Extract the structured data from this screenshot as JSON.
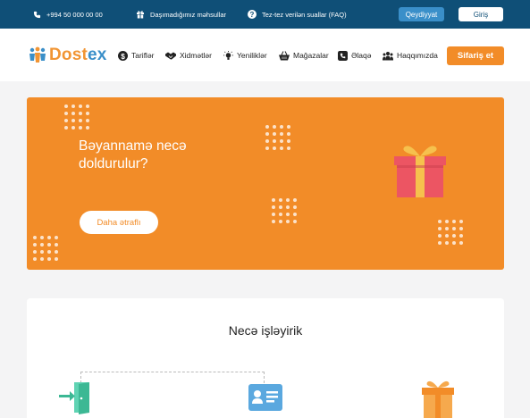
{
  "topbar": {
    "phone": "+994 50 000 00 00",
    "undeclared": "Daşımadığımız məhsullar",
    "faq": "Tez-tez verilən suallar (FAQ)",
    "register": "Qeydiyyat",
    "login": "Giriş"
  },
  "logo": {
    "part1": "Dost",
    "part2": "ex"
  },
  "nav": {
    "items": [
      {
        "label": "Tariflər",
        "icon": "dollar-icon"
      },
      {
        "label": "Xidmətlər",
        "icon": "handshake-icon"
      },
      {
        "label": "Yeniliklər",
        "icon": "lightbulb-icon"
      },
      {
        "label": "Mağazalar",
        "icon": "basket-icon"
      },
      {
        "label": "Əlaqə",
        "icon": "contact-icon"
      },
      {
        "label": "Haqqımızda",
        "icon": "users-icon"
      }
    ],
    "order": "Sifariş et"
  },
  "banner": {
    "title": "Bəyannamə necə doldurulur?",
    "button": "Daha ətraflı",
    "icon": "gift-icon"
  },
  "how": {
    "title": "Necə işləyirik",
    "steps": [
      {
        "icon": "login-door-icon"
      },
      {
        "icon": "id-card-icon"
      },
      {
        "icon": "gift-icon"
      }
    ]
  },
  "colors": {
    "topbar": "#0f4f77",
    "accent": "#f28c28",
    "blue": "#3a8fc9"
  }
}
